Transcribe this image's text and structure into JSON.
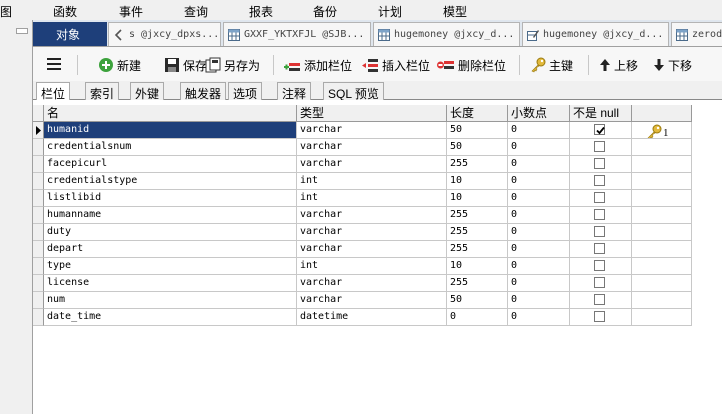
{
  "menu": [
    "图",
    "函数",
    "事件",
    "查询",
    "报表",
    "备份",
    "计划",
    "模型"
  ],
  "tabs": [
    {
      "label": "对象",
      "icon": "",
      "active": true
    },
    {
      "label": "s @jxcy_dpxs...",
      "icon": "chevron-left-icon",
      "active": false
    },
    {
      "label": "GXXF_YKTXFJL @SJB...",
      "icon": "table-icon",
      "active": false
    },
    {
      "label": "hugemoney @jxcy_d...",
      "icon": "table-icon",
      "active": false
    },
    {
      "label": "hugemoney @jxcy_d...",
      "icon": "table-design-icon",
      "active": false
    },
    {
      "label": "zerod",
      "icon": "table-icon",
      "active": false
    }
  ],
  "toolbar": {
    "new": "新建",
    "save": "保存",
    "save_as": "另存为",
    "add_field": "添加栏位",
    "insert_field": "插入栏位",
    "delete_field": "删除栏位",
    "primary_key": "主键",
    "move_up": "上移",
    "move_down": "下移"
  },
  "subtabs": [
    "栏位",
    "索引",
    "外键",
    "触发器",
    "选项",
    "注释",
    "SQL 预览"
  ],
  "columns": [
    "名",
    "类型",
    "长度",
    "小数点",
    "不是 null",
    ""
  ],
  "rows": [
    {
      "name": "humanid",
      "type": "varchar",
      "length": "50",
      "decimals": "0",
      "not_null": true,
      "key": "1"
    },
    {
      "name": "credentialsnum",
      "type": "varchar",
      "length": "50",
      "decimals": "0",
      "not_null": false,
      "key": ""
    },
    {
      "name": "facepicurl",
      "type": "varchar",
      "length": "255",
      "decimals": "0",
      "not_null": false,
      "key": ""
    },
    {
      "name": "credentialstype",
      "type": "int",
      "length": "10",
      "decimals": "0",
      "not_null": false,
      "key": ""
    },
    {
      "name": "listlibid",
      "type": "int",
      "length": "10",
      "decimals": "0",
      "not_null": false,
      "key": ""
    },
    {
      "name": "humanname",
      "type": "varchar",
      "length": "255",
      "decimals": "0",
      "not_null": false,
      "key": ""
    },
    {
      "name": "duty",
      "type": "varchar",
      "length": "255",
      "decimals": "0",
      "not_null": false,
      "key": ""
    },
    {
      "name": "depart",
      "type": "varchar",
      "length": "255",
      "decimals": "0",
      "not_null": false,
      "key": ""
    },
    {
      "name": "type",
      "type": "int",
      "length": "10",
      "decimals": "0",
      "not_null": false,
      "key": ""
    },
    {
      "name": "license",
      "type": "varchar",
      "length": "255",
      "decimals": "0",
      "not_null": false,
      "key": ""
    },
    {
      "name": "num",
      "type": "varchar",
      "length": "50",
      "decimals": "0",
      "not_null": false,
      "key": ""
    },
    {
      "name": "date_time",
      "type": "datetime",
      "length": "0",
      "decimals": "0",
      "not_null": false,
      "key": ""
    }
  ],
  "colors": {
    "selection": "#1e3f7a",
    "tab_active": "#1e3f7a",
    "key_gold": "#e2b93b"
  }
}
